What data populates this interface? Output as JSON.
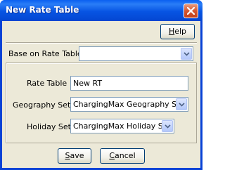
{
  "window": {
    "title": "New Rate Table"
  },
  "toolbar": {
    "help_label": "Help",
    "help_mnemonic": "H",
    "help_rest": "elp"
  },
  "base": {
    "label": "Base on Rate Table",
    "value": ""
  },
  "form": {
    "rate_table_label": "Rate Table",
    "rate_table_value": "New RT",
    "geography_label": "Geography Set",
    "geography_value": "ChargingMax Geography Set",
    "holiday_label": "Holiday Set",
    "holiday_value": "ChargingMax Holiday Set"
  },
  "footer": {
    "save_label": "Save",
    "save_mnemonic": "S",
    "save_rest": "ave",
    "cancel_label": "Cancel",
    "cancel_mnemonic": "C",
    "cancel_rest": "ancel"
  },
  "icons": {
    "close": "close-icon",
    "dropdown": "chevron-down-icon"
  }
}
